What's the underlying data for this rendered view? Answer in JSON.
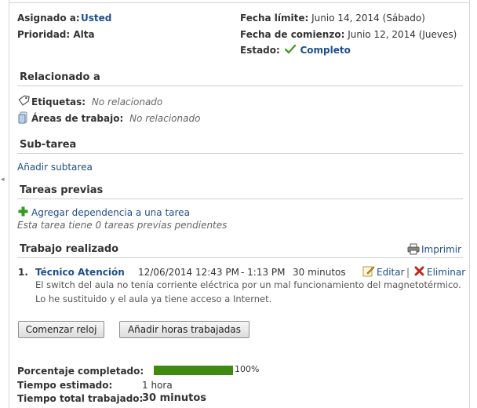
{
  "summary": {
    "assigned_label": "Asignado a:",
    "assigned_value": "Usted",
    "priority_label": "Prioridad:",
    "priority_value": "Alta",
    "due_label": "Fecha límite:",
    "due_value": "Junio 14, 2014 (Sábado)",
    "start_label": "Fecha de comienzo:",
    "start_value": "Junio 12, 2014 (Jueves)",
    "status_label": "Estado:",
    "status_value": "Completo"
  },
  "related": {
    "title": "Relacionado a",
    "tags_label": "Etiquetas:",
    "tags_value": "No relacionado",
    "areas_label": "Áreas de trabajo:",
    "areas_value": "No relacionado"
  },
  "subtask": {
    "title": "Sub-tarea",
    "add_link": "Añadir subtarea"
  },
  "prereqs": {
    "title": "Tareas previas",
    "add_link": "Agregar dependencia a una tarea",
    "note": "Esta tarea tiene 0 tareas previas pendientes"
  },
  "work": {
    "title": "Trabajo realizado",
    "print_link": "Imprimir",
    "entries": [
      {
        "number": "1.",
        "person": "Técnico Atención",
        "datetime": "12/06/2014 12:43 PM",
        "range_end": "- 1:13 PM",
        "duration": "30 minutos",
        "edit_link": "Editar",
        "separator": "|",
        "delete_link": "Eliminar",
        "note_line1": "El switch del aula no tenía corriente eléctrica por un mal funcionamiento del magnetotérmico.",
        "note_line2": "Lo he sustituido y el aula ya tiene acceso a Internet."
      }
    ]
  },
  "buttons": {
    "start_clock": "Comenzar reloj",
    "add_hours": "Añadir horas trabajadas"
  },
  "stats": {
    "percent_label": "Porcentaje completado:",
    "percent_value": 1.0,
    "percent_text": "100%",
    "estimated_label": "Tiempo estimado:",
    "estimated_value": "1 hora",
    "total_label": "Tiempo total trabajado:",
    "total_value": "30 minutos"
  },
  "colors": {
    "link": "#1f4e8c",
    "progress": "#3f8a10",
    "check": "#4a9a2a",
    "delete": "#c0281c"
  },
  "icons": {
    "status": "check-icon",
    "tags": "tag-icon",
    "areas": "folder-icon",
    "add": "plus-icon",
    "print": "printer-icon",
    "edit": "pencil-icon",
    "delete": "x-icon"
  }
}
